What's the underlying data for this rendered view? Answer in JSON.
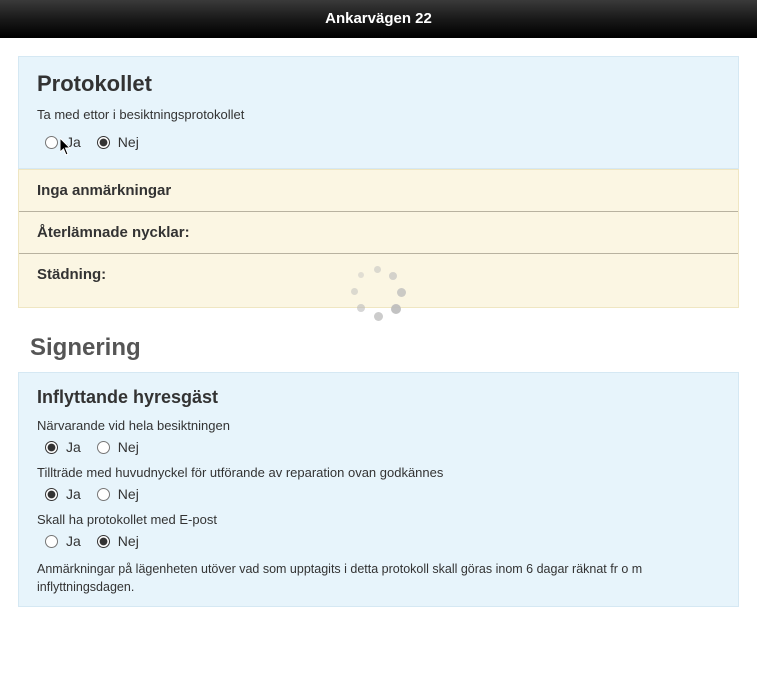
{
  "header": {
    "title": "Ankarvägen 22"
  },
  "protokollet": {
    "title": "Protokollet",
    "subtext": "Ta med ettor i besiktningsprotokollet",
    "ja": "Ja",
    "nej": "Nej",
    "selected": "nej"
  },
  "cream": {
    "row1": "Inga anmärkningar",
    "row2": "Återlämnade nycklar:",
    "row3": "Städning:"
  },
  "signering": {
    "title": "Signering",
    "inflyttande": {
      "title": "Inflyttande hyresgäst",
      "q1": "Närvarande vid hela besiktningen",
      "q1_ja": "Ja",
      "q1_nej": "Nej",
      "q1_selected": "ja",
      "q2": "Tillträde med huvudnyckel för utförande av reparation ovan godkännes",
      "q2_ja": "Ja",
      "q2_nej": "Nej",
      "q2_selected": "ja",
      "q3": "Skall ha protokollet med E-post",
      "q3_ja": "Ja",
      "q3_nej": "Nej",
      "q3_selected": "nej",
      "footnote": "Anmärkningar på lägenheten utöver vad som upptagits i detta protokoll skall göras inom 6 dagar räknat fr o m inflyttningsdagen."
    }
  }
}
